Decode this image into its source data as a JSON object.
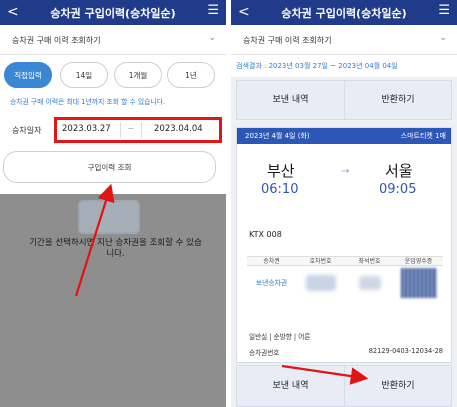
{
  "left": {
    "header": {
      "back": "<",
      "title": "승차권 구입이력(승차일순)",
      "menu": "☰"
    },
    "dropdown": {
      "label": "승차권 구매 이력 조회하기",
      "chevron": "⌄"
    },
    "periods": [
      {
        "label": "직접입력",
        "active": true
      },
      {
        "label": "14일",
        "active": false
      },
      {
        "label": "1개월",
        "active": false
      },
      {
        "label": "1년",
        "active": false
      }
    ],
    "notice": "승차권 구매 이력은 최대 1년까지 조회 할 수 있습니다.",
    "date_label": "승차일자",
    "date_from": "2023.03.27",
    "date_sep": "~",
    "date_to": "2023.04.04",
    "search_button": "구입이력 조회",
    "empty_message": "기간을 선택하시면 지난 승차권을 조회할 수 있습니다."
  },
  "right": {
    "header": {
      "back": "<",
      "title": "승차권 구입이력(승차일순)",
      "menu": "☰"
    },
    "dropdown": {
      "label": "승차권 구매 이력 조회하기",
      "chevron": "⌄"
    },
    "result": "검색결과 : 2023년 03월 27일 ~ 2023년 04월 04일",
    "tabs_top": {
      "sent": "보낸 내역",
      "refund": "반환하기"
    },
    "ticket": {
      "date": "2023년 4월 4일 (화)",
      "type": "스마트티켓 1매",
      "from": "부산",
      "to": "서울",
      "dep_time": "06:10",
      "arr_time": "09:05",
      "arrow": "→",
      "train": "KTX 008",
      "columns": [
        "승차권",
        "호차번호",
        "좌석번호",
        "운임영수증"
      ],
      "row_status": "보낸승차권",
      "passenger": "일반실 | 순방향 | 어른",
      "ticket_no_label": "승차권번호",
      "ticket_no": "82129-0403-12034-28"
    },
    "tabs_bottom": {
      "sent": "보낸 내역",
      "refund": "반환하기"
    }
  },
  "colors": {
    "header": "#1f3b8a",
    "accent": "#3a87d6",
    "highlight": "#e11717"
  }
}
